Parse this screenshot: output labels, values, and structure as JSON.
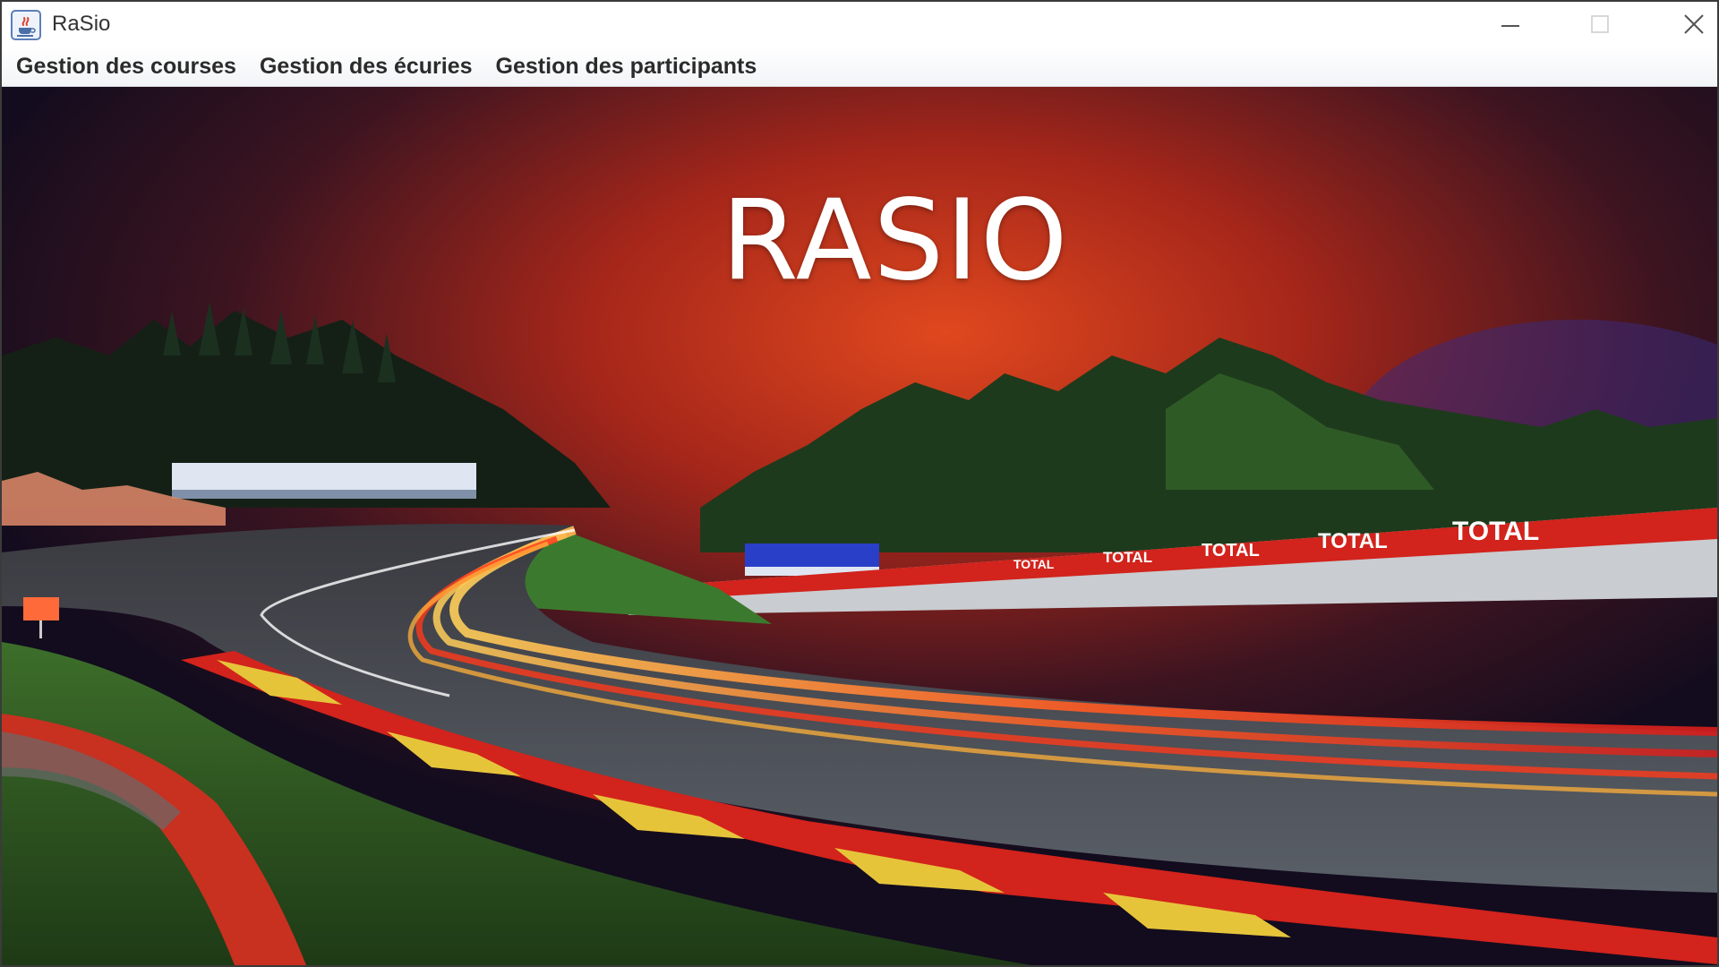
{
  "window": {
    "title": "RaSio"
  },
  "menubar": {
    "items": [
      {
        "label": "Gestion des courses"
      },
      {
        "label": "Gestion des écuries"
      },
      {
        "label": "Gestion des participants"
      }
    ]
  },
  "main": {
    "hero_title": "RASIO",
    "sponsor_banner": "TOTAL"
  },
  "colors": {
    "sky_glow": "#c8321a",
    "sky_dark": "#120c1e",
    "kerb_red": "#d2231c",
    "kerb_yellow": "#e6c43a",
    "grass": "#3f7a2e"
  },
  "icons": {
    "app": "java-cup-icon",
    "minimize": "minimize-icon",
    "maximize": "maximize-icon",
    "close": "close-icon"
  }
}
